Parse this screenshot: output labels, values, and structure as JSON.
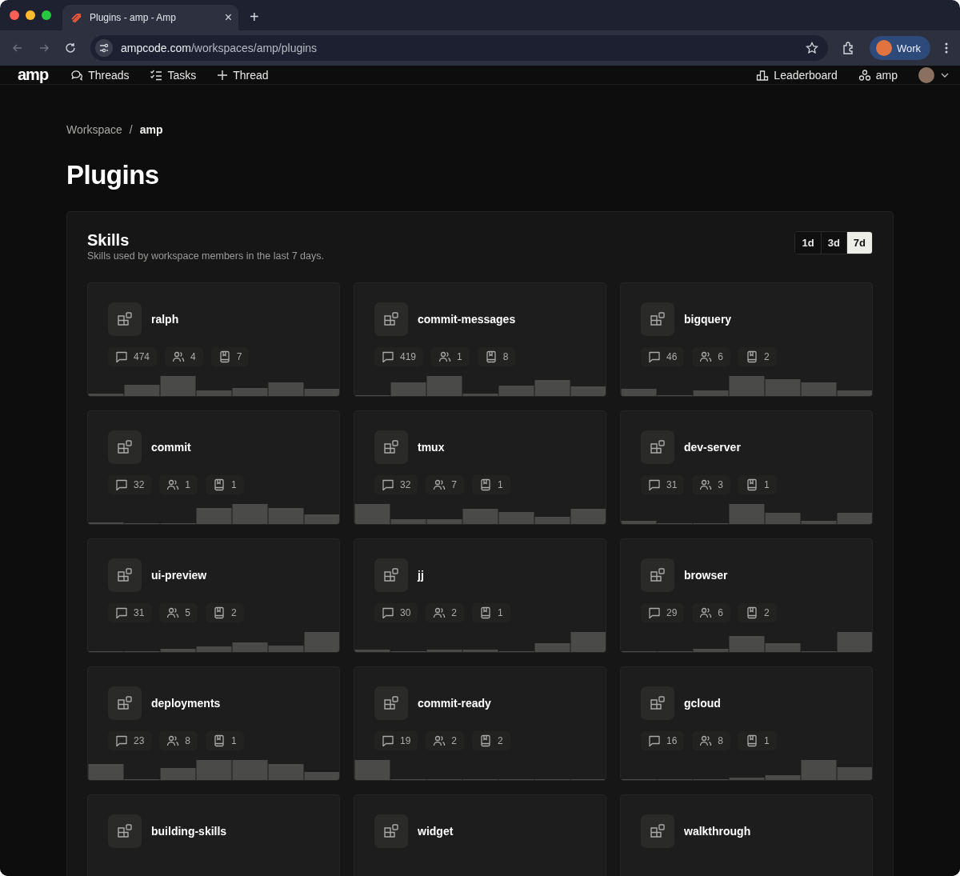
{
  "browser": {
    "tab": {
      "title": "Plugins - amp - Amp",
      "close": "×"
    },
    "new_tab": "+",
    "url": {
      "domain": "ampcode.com",
      "path": "/workspaces/amp/plugins"
    },
    "profile": "Work"
  },
  "nav": {
    "logo": "amp",
    "items": [
      {
        "label": "Threads",
        "kind": "threads"
      },
      {
        "label": "Tasks",
        "kind": "tasks"
      },
      {
        "label": "Thread",
        "kind": "new"
      }
    ],
    "right": [
      {
        "label": "Leaderboard",
        "kind": "leaderboard"
      },
      {
        "label": "amp",
        "kind": "workspace"
      }
    ]
  },
  "breadcrumb": [
    {
      "label": "Workspace",
      "current": false
    },
    {
      "label": "amp",
      "current": true
    }
  ],
  "breadcrumb_separator": "/",
  "title": "Plugins",
  "skills": {
    "title": "Skills",
    "subtitle": "Skills used by workspace members in the last 7 days.",
    "ranges": [
      {
        "label": "1d",
        "selected": false
      },
      {
        "label": "3d",
        "selected": false
      },
      {
        "label": "7d",
        "selected": true
      }
    ],
    "cards": [
      {
        "name": "ralph",
        "stats": [
          {
            "kind": "threads",
            "value": "474"
          },
          {
            "kind": "users",
            "value": "4"
          },
          {
            "kind": "files",
            "value": "7"
          }
        ]
      },
      {
        "name": "commit-messages",
        "stats": [
          {
            "kind": "threads",
            "value": "419"
          },
          {
            "kind": "users",
            "value": "1"
          },
          {
            "kind": "files",
            "value": "8"
          }
        ]
      },
      {
        "name": "bigquery",
        "stats": [
          {
            "kind": "threads",
            "value": "46"
          },
          {
            "kind": "users",
            "value": "6"
          },
          {
            "kind": "files",
            "value": "2"
          }
        ]
      },
      {
        "name": "commit",
        "stats": [
          {
            "kind": "threads",
            "value": "32"
          },
          {
            "kind": "users",
            "value": "1"
          },
          {
            "kind": "files",
            "value": "1"
          }
        ]
      },
      {
        "name": "tmux",
        "stats": [
          {
            "kind": "threads",
            "value": "32"
          },
          {
            "kind": "users",
            "value": "7"
          },
          {
            "kind": "files",
            "value": "1"
          }
        ]
      },
      {
        "name": "dev-server",
        "stats": [
          {
            "kind": "threads",
            "value": "31"
          },
          {
            "kind": "users",
            "value": "3"
          },
          {
            "kind": "files",
            "value": "1"
          }
        ]
      },
      {
        "name": "ui-preview",
        "stats": [
          {
            "kind": "threads",
            "value": "31"
          },
          {
            "kind": "users",
            "value": "5"
          },
          {
            "kind": "files",
            "value": "2"
          }
        ]
      },
      {
        "name": "jj",
        "stats": [
          {
            "kind": "threads",
            "value": "30"
          },
          {
            "kind": "users",
            "value": "2"
          },
          {
            "kind": "files",
            "value": "1"
          }
        ]
      },
      {
        "name": "browser",
        "stats": [
          {
            "kind": "threads",
            "value": "29"
          },
          {
            "kind": "users",
            "value": "6"
          },
          {
            "kind": "files",
            "value": "2"
          }
        ]
      },
      {
        "name": "deployments",
        "stats": [
          {
            "kind": "threads",
            "value": "23"
          },
          {
            "kind": "users",
            "value": "8"
          },
          {
            "kind": "files",
            "value": "1"
          }
        ]
      },
      {
        "name": "commit-ready",
        "stats": [
          {
            "kind": "threads",
            "value": "19"
          },
          {
            "kind": "users",
            "value": "2"
          },
          {
            "kind": "files",
            "value": "2"
          }
        ]
      },
      {
        "name": "gcloud",
        "stats": [
          {
            "kind": "threads",
            "value": "16"
          },
          {
            "kind": "users",
            "value": "8"
          },
          {
            "kind": "files",
            "value": "1"
          }
        ]
      },
      {
        "name": "building-skills"
      },
      {
        "name": "widget"
      },
      {
        "name": "walkthrough"
      }
    ]
  }
}
